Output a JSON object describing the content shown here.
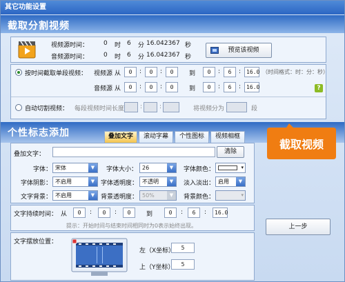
{
  "window": {
    "title": "其它功能设置"
  },
  "colors": {
    "accent_orange": "#f07d12",
    "title_blue": "#2c66c3",
    "help_green": "#8dbb24"
  },
  "section1": {
    "title": "截取分割视频",
    "video_label": "视频源时间：",
    "video_h": "0",
    "video_m": "6",
    "video_s": "16.042367",
    "audio_label": "音频源时间：",
    "audio_h": "0",
    "audio_m": "6",
    "audio_s": "16.042367",
    "u_hour": "时",
    "u_min": "分",
    "u_sec": "秒",
    "preview_button": "预览该视频",
    "mode_time_label": "按时间截取单段视频：",
    "vsrc_label": "视频源",
    "asrc_label": "音频源",
    "from": "从",
    "to": "到",
    "video_from": [
      "0",
      "0",
      "0"
    ],
    "video_to": [
      "0",
      "6",
      "16.0"
    ],
    "audio_from": [
      "0",
      "0",
      "0"
    ],
    "audio_to": [
      "0",
      "6",
      "16.0"
    ],
    "time_format": "（时间格式：时：分：秒）",
    "help": "?",
    "mode_auto_label": "自动切割视频：",
    "seg_len_label": "每段视频时间长度",
    "split_label": "将视频分为",
    "seg_unit": "段"
  },
  "callout": "截取视频",
  "section2": {
    "title": "个性标志添加",
    "tabs": [
      "叠加文字",
      "滚动字幕",
      "个性图标",
      "视频相框"
    ],
    "overlay_text_label": "叠加文字：",
    "overlay_text_value": "",
    "clear_button": "清除",
    "font_label": "字体：",
    "font_value": "宋体",
    "font_size_label": "字体大小：",
    "font_size_value": "26",
    "font_color_label": "字体颜色：",
    "shadow_label": "字体阴影：",
    "shadow_value": "不启用",
    "font_alpha_label": "字体透明度：",
    "font_alpha_value": "不透明",
    "fade_label": "淡入淡出：",
    "fade_value": "启用",
    "bg_label": "文字背景：",
    "bg_value": "不启用",
    "bg_alpha_label": "背景透明度：",
    "bg_alpha_value": "50%",
    "bg_color_label": "背景颜色：",
    "duration_label": "文字持续时间：",
    "dur_from": [
      "0",
      "0",
      "0"
    ],
    "dur_to": [
      "0",
      "6",
      "16.0"
    ],
    "hint": "提示：开始时间与结束时间相同时为0表示始终出现。",
    "pos_label": "文字摆放位置：",
    "left_label": "左（X坐标）",
    "left_value": "5",
    "top_label": "上（Y坐标）",
    "top_value": "5"
  },
  "prev_button": "上一步"
}
